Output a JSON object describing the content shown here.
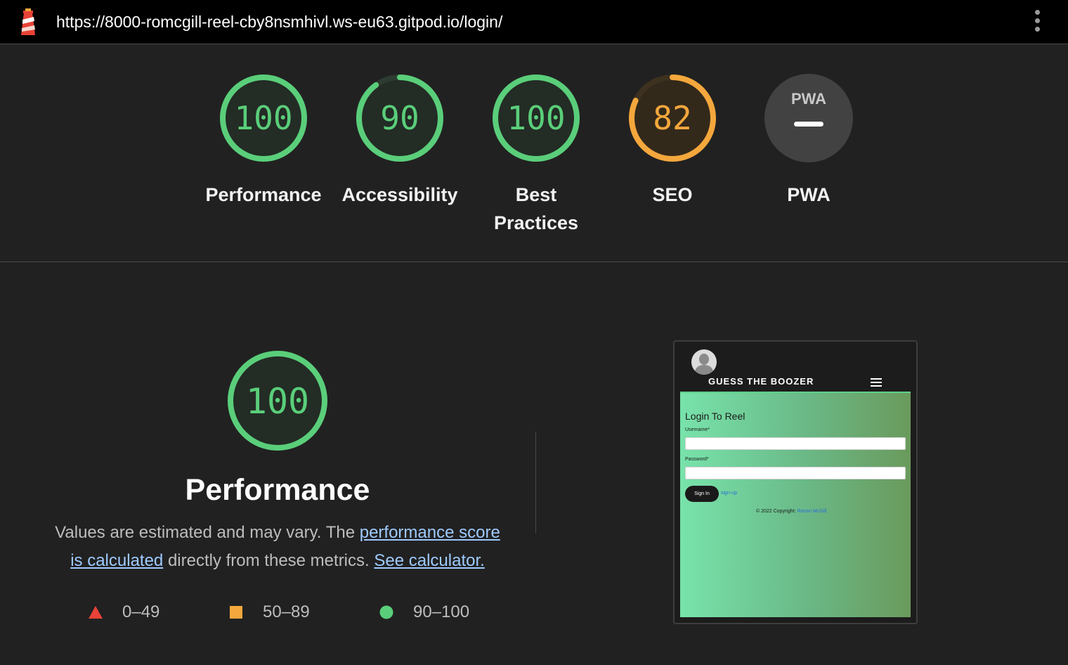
{
  "topbar": {
    "url": "https://8000-romcgill-reel-cby8nsmhivl.ws-eu63.gitpod.io/login/",
    "logo_icon": "lighthouse-icon",
    "menu_icon": "more-vertical-icon"
  },
  "colors": {
    "pass": "#5ace7a",
    "average": "#f4a73c",
    "fail": "#e94236",
    "na": "#ffffff"
  },
  "gauges": [
    {
      "score": "100",
      "label": "Performance",
      "status": "pass",
      "fraction": 1.0
    },
    {
      "score": "90",
      "label": "Accessibility",
      "status": "pass",
      "fraction": 0.9
    },
    {
      "score": "100",
      "label_line1": "Best",
      "label_line2": "Practices",
      "status": "pass",
      "fraction": 1.0
    },
    {
      "score": "82",
      "label": "SEO",
      "status": "average",
      "fraction": 0.82
    },
    {
      "badge": "PWA",
      "label": "PWA",
      "status": "na"
    }
  ],
  "performance": {
    "score": "100",
    "fraction": 1.0,
    "title": "Performance",
    "desc_before": "Values are estimated and may vary. The ",
    "link_score": "performance score is calculated",
    "desc_middle": " directly from these metrics. ",
    "link_calculator": "See calculator.",
    "legend": [
      {
        "shape": "triangle",
        "range": "0–49"
      },
      {
        "shape": "square",
        "range": "50–89"
      },
      {
        "shape": "circle",
        "range": "90–100"
      }
    ]
  },
  "thumbnail": {
    "brand": "GUESS THE BOOZER",
    "login_title": "Login To Reel",
    "username_label": "Username*",
    "password_label": "Password*",
    "signin_label": "Sign In",
    "signup_link": "sign-up",
    "footer_text": "© 2022 Copyright: ",
    "footer_author": "Ronan McGill"
  }
}
